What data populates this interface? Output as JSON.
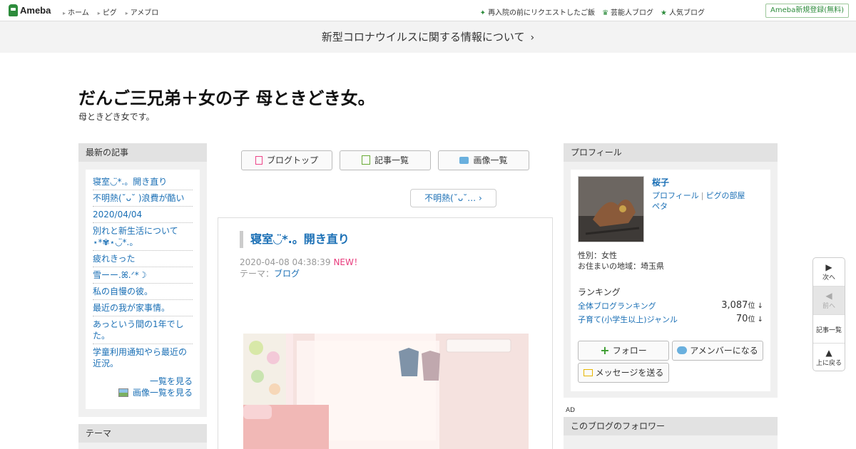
{
  "header": {
    "logo": "Ameba",
    "nav": [
      "ホーム",
      "ピグ",
      "アメブロ"
    ],
    "links": [
      {
        "icon": "sparkle-icon",
        "label": "再入院の前にリクエストしたご飯"
      },
      {
        "icon": "crown-icon",
        "label": "芸能人ブログ"
      },
      {
        "icon": "star-icon",
        "label": "人気ブログ"
      }
    ],
    "register": "Ameba新規登録(無料)"
  },
  "notice": "新型コロナウイルスに関する情報について",
  "blog": {
    "title": "だんご三兄弟＋女の子 母ときどき女。",
    "description": "母ときどき女です。"
  },
  "recent": {
    "heading": "最新の記事",
    "items": [
      "寝室◡̈*.。開き直り",
      "不明熱(˘ᴗ˘ )浪費が酷い",
      "2020/04/04",
      "別れと新生活について ⋆*✾⋆◡̈*.。",
      "疲れきった",
      "雪ーー.ꕤ.ᐟ*☽",
      "私の自慢の彼。",
      "最近の我が家事情。",
      "あっという間の1年でした。",
      "学童利用通知やら最近の近況。"
    ],
    "more": "一覧を見る",
    "more_images": "画像一覧を見る"
  },
  "theme_box": {
    "heading": "テーマ"
  },
  "center": {
    "buttons": [
      "ブログトップ",
      "記事一覧",
      "画像一覧"
    ],
    "prev_link": "不明熱(˘ᴗ˘…"
  },
  "entry": {
    "title": "寝室◡̈*.。開き直り",
    "datetime": "2020-04-08 04:38:39",
    "new_badge": "NEW！",
    "theme_label": "テーマ：",
    "theme_value": "ブログ"
  },
  "profile": {
    "heading": "プロフィール",
    "name": "桜子",
    "link_profile": "プロフィール",
    "link_pig": "ピグの部屋",
    "link_peta": "ペタ",
    "gender": "性別：女性",
    "location": "お住まいの地域：埼玉県",
    "ranking_heading": "ランキング",
    "rankings": [
      {
        "label": "全体ブログランキング",
        "value": "3,087",
        "unit": "位 ↓"
      },
      {
        "label": "子育て(小学生以上)ジャンル",
        "value": "70",
        "unit": "位 ↓"
      }
    ],
    "follow": "フォロー",
    "member": "アメンバーになる",
    "message": "メッセージを送る"
  },
  "ad_label": "AD",
  "followers_heading": "このブログのフォロワー",
  "floatnav": {
    "next": "次へ",
    "prev": "前へ",
    "list": "記事一覧",
    "top": "上に戻る"
  }
}
